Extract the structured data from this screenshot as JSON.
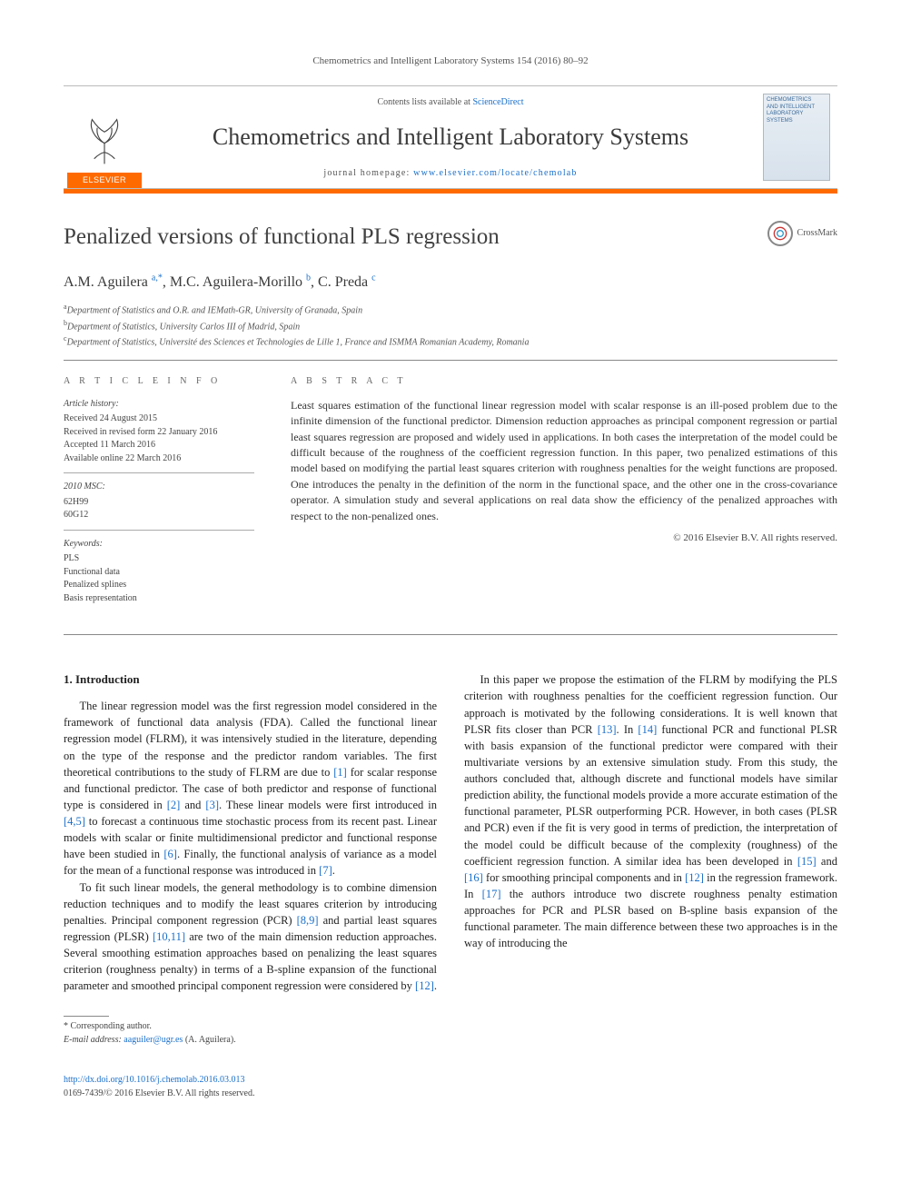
{
  "journal_ref": "Chemometrics and Intelligent Laboratory Systems 154 (2016) 80–92",
  "masthead": {
    "publisher": "ELSEVIER",
    "contents_prefix": "Contents lists available at ",
    "contents_link": "ScienceDirect",
    "journal_name": "Chemometrics and Intelligent Laboratory Systems",
    "homepage_prefix": "journal homepage: ",
    "homepage_url": "www.elsevier.com/locate/chemolab",
    "cover_lines": [
      "CHEMOMETRICS",
      "AND INTELLIGENT",
      "LABORATORY",
      "SYSTEMS"
    ]
  },
  "title": "Penalized versions of functional PLS regression",
  "crossmark_label": "CrossMark",
  "authors_html": "A.M. Aguilera <sup>a,*</sup>, M.C. Aguilera-Morillo <sup>b</sup>, C. Preda <sup>c</sup>",
  "affiliations": [
    {
      "sup": "a",
      "text": "Department of Statistics and O.R. and IEMath-GR, University of Granada, Spain"
    },
    {
      "sup": "b",
      "text": "Department of Statistics, University Carlos III of Madrid, Spain"
    },
    {
      "sup": "c",
      "text": "Department of Statistics, Université des Sciences et Technologies de Lille 1, France and ISMMA Romanian Academy, Romania"
    }
  ],
  "info": {
    "heading": "A R T I C L E   I N F O",
    "history_label": "Article history:",
    "history": [
      "Received 24 August 2015",
      "Received in revised form 22 January 2016",
      "Accepted 11 March 2016",
      "Available online 22 March 2016"
    ],
    "msc_label": "2010 MSC:",
    "msc": [
      "62H99",
      "60G12"
    ],
    "keywords_label": "Keywords:",
    "keywords": [
      "PLS",
      "Functional data",
      "Penalized splines",
      "Basis representation"
    ]
  },
  "abstract": {
    "heading": "A B S T R A C T",
    "text": "Least squares estimation of the functional linear regression model with scalar response is an ill-posed problem due to the infinite dimension of the functional predictor. Dimension reduction approaches as principal component regression or partial least squares regression are proposed and widely used in applications. In both cases the interpretation of the model could be difficult because of the roughness of the coefficient regression function. In this paper, two penalized estimations of this model based on modifying the partial least squares criterion with roughness penalties for the weight functions are proposed. One introduces the penalty in the definition of the norm in the functional space, and the other one in the cross-covariance operator. A simulation study and several applications on real data show the efficiency of the penalized approaches with respect to the non-penalized ones.",
    "copyright": "© 2016 Elsevier B.V. All rights reserved."
  },
  "section1_heading": "1.  Introduction",
  "para1": "The linear regression model was the first regression model considered in the framework of functional data analysis (FDA). Called the functional linear regression model (FLRM), it was intensively studied in the literature, depending on the type of the response and the predictor random variables. The first theoretical contributions to the study of FLRM are due to [1] for scalar response and functional predictor. The case of both predictor and response of functional type is considered in [2] and [3]. These linear models were first introduced in [4,5] to forecast a continuous time stochastic process from its recent past. Linear models with scalar or finite multidimensional predictor and functional response have been studied in [6]. Finally, the functional analysis of variance as a model for the mean of a functional response was introduced in [7].",
  "para2": "To fit such linear models, the general methodology is to combine dimension reduction techniques and to modify the least squares criterion by introducing penalties. Principal component regression (PCR) [8,9] and partial least squares regression (PLSR) [10,11] are two of the main dimension reduction approaches. Several smoothing estimation approaches based on penalizing the least squares criterion (roughness penalty) in terms of a B-spline expansion of the functional parameter and smoothed principal component regression were considered by [12].",
  "para3": "In this paper we propose the estimation of the FLRM by modifying the PLS criterion with roughness penalties for the coefficient regression function. Our approach is motivated by the following considerations. It is well known that PLSR fits closer than PCR [13]. In [14] functional PCR and functional PLSR with basis expansion of the functional predictor were compared with their multivariate versions by an extensive simulation study. From this study, the authors concluded that, although discrete and functional models have similar prediction ability, the functional models provide a more accurate estimation of the functional parameter, PLSR outperforming PCR. However, in both cases (PLSR and PCR) even if the fit is very good in terms of prediction, the interpretation of the model could be difficult because of the complexity (roughness) of the coefficient regression function. A similar idea has been developed in [15] and [16] for smoothing principal components and in [12] in the regression framework. In [17] the authors introduce two discrete roughness penalty estimation approaches for PCR and PLSR based on B-spline basis expansion of the functional parameter. The main difference between these two approaches is in the way of introducing the",
  "footnotes": {
    "corr": "* Corresponding author.",
    "email_label": "E-mail address:",
    "email": "aaguiler@ugr.es",
    "email_attrib": "(A. Aguilera)."
  },
  "footer": {
    "doi": "http://dx.doi.org/10.1016/j.chemolab.2016.03.013",
    "issn_line": "0169-7439/© 2016 Elsevier B.V. All rights reserved."
  }
}
